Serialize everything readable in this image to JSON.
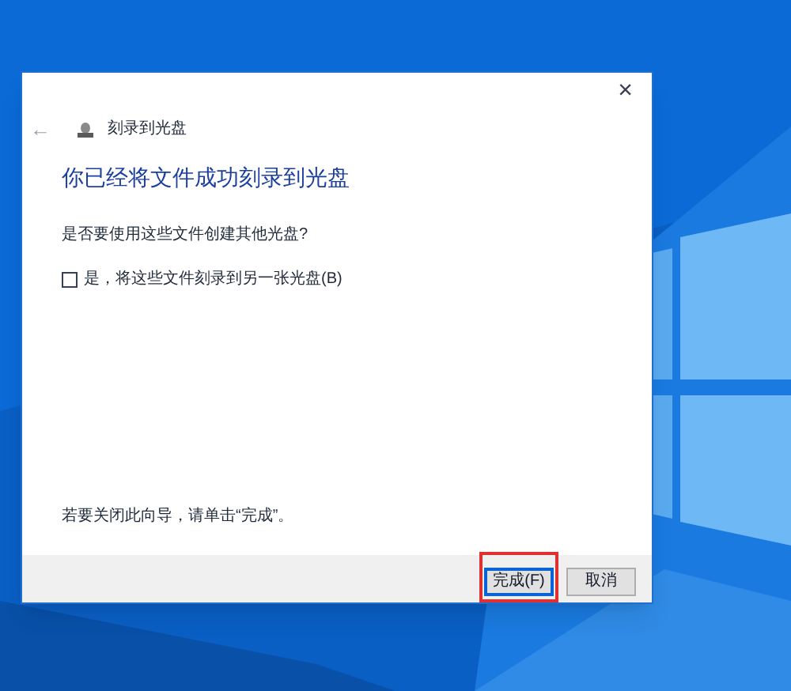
{
  "window": {
    "close": "×",
    "back": "←",
    "title": "刻录到光盘"
  },
  "heading": "你已经将文件成功刻录到光盘",
  "question": "是否要使用这些文件创建其他光盘?",
  "option": {
    "label": "是，将这些文件刻录到另一张光盘(B)",
    "checked": false
  },
  "hint": "若要关闭此向导，请单击“完成”。",
  "buttons": [
    {
      "label": "完成(F)",
      "default": true,
      "highlighted": true
    },
    {
      "label": "取消",
      "default": false,
      "highlighted": false
    }
  ]
}
